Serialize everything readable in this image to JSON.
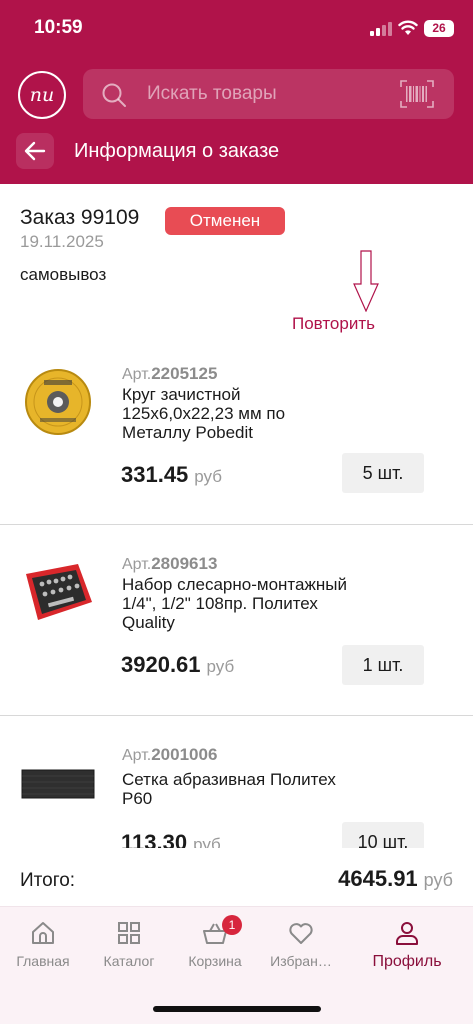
{
  "status_bar": {
    "time": "10:59",
    "battery": "26"
  },
  "header": {
    "logo_text": "пи",
    "search_placeholder": "Искать товары",
    "title": "Информация о заказе"
  },
  "order": {
    "title": "Заказ 99109",
    "status": "Отменен",
    "date": "19.11.2025",
    "delivery": "самовывоз",
    "repeat_label": "Повторить"
  },
  "items": [
    {
      "art_prefix": "Арт.",
      "art": "2205125",
      "name": "Круг зачистной 125х6,0х22,23 мм по Металлу Pobedit",
      "price": "331.45",
      "currency": "руб",
      "qty": "5 шт.",
      "image": "grinding-disc-icon"
    },
    {
      "art_prefix": "Арт.",
      "art": "2809613",
      "name": "Набор слесарно-монтажный 1/4\", 1/2\" 108пр. Политех Quality",
      "price": "3920.61",
      "currency": "руб",
      "qty": "1 шт.",
      "image": "tool-set-case-icon"
    },
    {
      "art_prefix": "Арт.",
      "art": "2001006",
      "name": "Сетка абразивная Политех Р60",
      "price": "113.30",
      "currency": "руб",
      "qty": "10 шт.",
      "image": "abrasive-mesh-icon"
    }
  ],
  "total": {
    "label": "Итого:",
    "value": "4645.91",
    "currency": "руб"
  },
  "tabs": [
    {
      "label": "Главная",
      "icon": "home-icon"
    },
    {
      "label": "Каталог",
      "icon": "grid-icon"
    },
    {
      "label": "Корзина",
      "icon": "basket-icon",
      "badge": "1"
    },
    {
      "label": "Избран…",
      "icon": "heart-icon"
    },
    {
      "label": "Профиль",
      "icon": "person-icon",
      "active": true
    }
  ],
  "colors": {
    "brand": "#b0134a",
    "badge": "#e84c54",
    "active_tab": "#8a0f3b"
  }
}
